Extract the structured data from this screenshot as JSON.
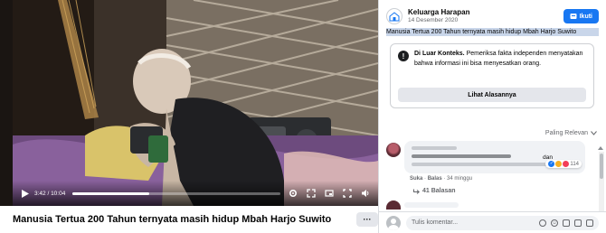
{
  "video": {
    "time_label": "3:42 / 10:04",
    "progress": 0.37,
    "title": "Manusia Tertua 200 Tahun ternyata masih hidup Mbah Harjo Suwito",
    "more_label": "···"
  },
  "post": {
    "page_name": "Keluarga Harapan",
    "date": "14 Desember 2020",
    "follow_label": "Ikuti",
    "caption": "Manusia Tertua 200 Tahun ternyata masih hidup Mbah Harjo Suwito"
  },
  "fact_check": {
    "heading": "Di Luar Konteks.",
    "body": " Pemeriksa fakta independen menyatakan bahwa informasi ini bisa menyesatkan orang.",
    "button_label": "Lihat Alasannya"
  },
  "comments": {
    "sort_label": "Paling Relevan",
    "first": {
      "trailing_text": "dan",
      "reaction_count": "114",
      "like_label": "Suka",
      "reply_label": "Balas",
      "age": "34 minggu",
      "replies_label": "41 Balasan"
    },
    "composer_placeholder": "Tulis komentar..."
  },
  "colors": {
    "primary": "#1877f2",
    "fact_bg": "#ffffff",
    "highlight": "#c9d6ea"
  }
}
